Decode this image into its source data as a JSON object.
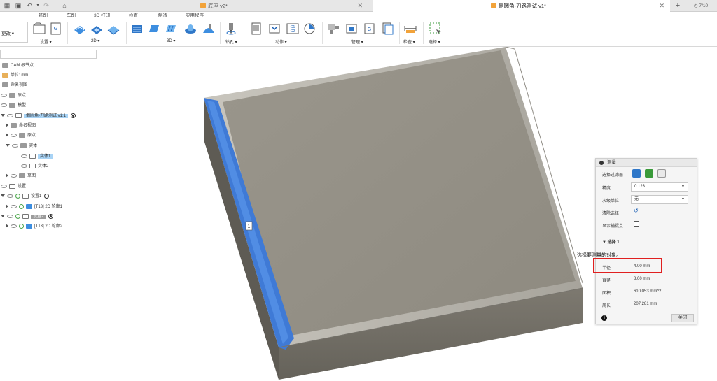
{
  "topbar": {
    "left_label": "更改",
    "tabs": [
      {
        "title": "底座 v2*",
        "active": false
      },
      {
        "title": "倒圆角-刀路测试 v1*",
        "active": true
      }
    ],
    "add_tab": "+",
    "page_counter": "7/10"
  },
  "ribbon": {
    "tabs": [
      "铣削",
      "车削",
      "3D 打印",
      "检查",
      "制造",
      "实用程序"
    ],
    "active_tab": "铣削",
    "left_label": "更改 ▾",
    "groups": [
      "设置 ▾",
      "2D ▾",
      "3D ▾",
      "钻孔 ▾",
      "动作 ▾",
      "管理 ▾",
      "检查 ▾",
      "选择 ▾"
    ]
  },
  "browser": {
    "search_value": "",
    "nodes": [
      {
        "label": "CAM 根节点"
      },
      {
        "label": "单位: mm"
      },
      {
        "label": "命名视图"
      },
      {
        "label": "原点"
      },
      {
        "label": "模型"
      },
      {
        "label": "倒圆角-刀路测试 v1:1"
      },
      {
        "label": "命名视图"
      },
      {
        "label": "原点"
      },
      {
        "label": "实体"
      },
      {
        "label": "实体1"
      },
      {
        "label": "实体2"
      },
      {
        "label": "草图"
      },
      {
        "label": "设置"
      },
      {
        "label": "设置1"
      },
      {
        "label": "[T13] 2D 轮廓1"
      },
      {
        "label": "设置2"
      },
      {
        "label": "[T13] 2D 轮廓2"
      }
    ]
  },
  "viewport": {
    "edge_marker": "1",
    "tooltip": "选择要测量的对象。"
  },
  "measure": {
    "title": "测量",
    "filter_label": "选择过滤器",
    "precision_label": "精度",
    "precision_value": "0.123",
    "secondary_unit_label": "次级单位",
    "secondary_unit_value": "无",
    "clear_label": "清除选择",
    "snap_label": "显示捕捉点",
    "selection_header": "选择 1",
    "results": [
      {
        "label": "半径",
        "value": "4.00 mm"
      },
      {
        "label": "直径",
        "value": "8.00 mm"
      },
      {
        "label": "面积",
        "value": "610.053 mm^2"
      },
      {
        "label": "周长",
        "value": "207.281 mm"
      }
    ],
    "close_label": "关闭",
    "info_icon": "i"
  }
}
